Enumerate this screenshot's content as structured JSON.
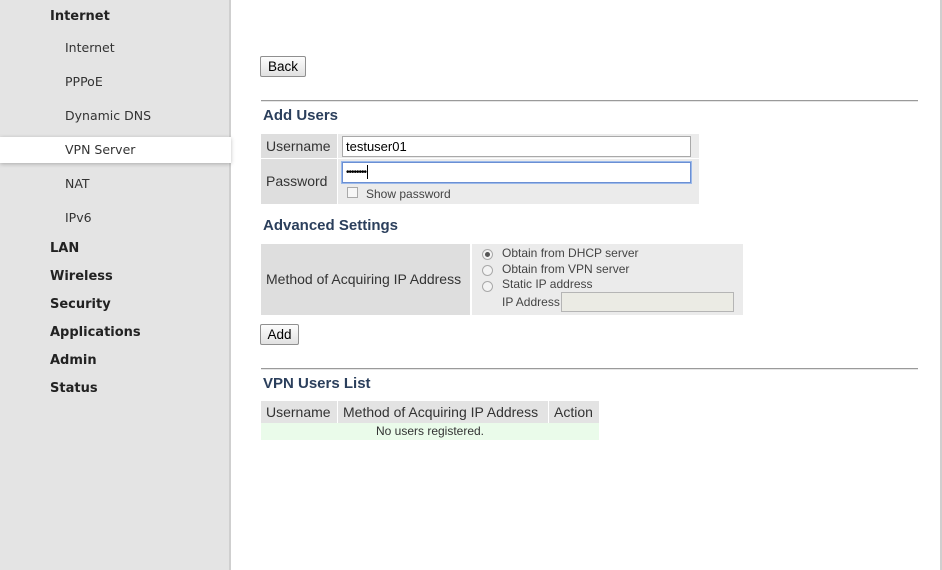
{
  "sidebar": {
    "items": [
      {
        "label": "Internet",
        "level": "top"
      },
      {
        "label": "Internet",
        "level": "sub"
      },
      {
        "label": "PPPoE",
        "level": "sub"
      },
      {
        "label": "Dynamic DNS",
        "level": "sub"
      },
      {
        "label": "VPN Server",
        "level": "sub",
        "active": true
      },
      {
        "label": "NAT",
        "level": "sub"
      },
      {
        "label": "IPv6",
        "level": "sub"
      },
      {
        "label": "LAN",
        "level": "top"
      },
      {
        "label": "Wireless",
        "level": "top"
      },
      {
        "label": "Security",
        "level": "top"
      },
      {
        "label": "Applications",
        "level": "top"
      },
      {
        "label": "Admin",
        "level": "top"
      },
      {
        "label": "Status",
        "level": "top"
      }
    ]
  },
  "main": {
    "back_label": "Back",
    "add_users": {
      "title": "Add Users",
      "username_label": "Username",
      "username_value": "testuser01",
      "password_label": "Password",
      "password_value": "••••••••",
      "show_password_label": "Show password",
      "show_password_checked": false
    },
    "advanced": {
      "title": "Advanced Settings",
      "method_label": "Method of Acquiring IP Address",
      "options": [
        {
          "label": "Obtain from DHCP server",
          "checked": true
        },
        {
          "label": "Obtain from VPN server",
          "checked": false
        },
        {
          "label": "Static IP address",
          "checked": false
        }
      ],
      "ip_address_label": "IP Address",
      "ip_address_value": ""
    },
    "add_label": "Add",
    "users_list": {
      "title": "VPN Users List",
      "columns": [
        "Username",
        "Method of Acquiring IP Address",
        "Action"
      ],
      "empty_text": "No users registered."
    }
  },
  "colors": {
    "sidebar_bg": "#e4e4e4",
    "section_title": "#2b3f5c",
    "empty_row_bg": "#eafbea"
  }
}
